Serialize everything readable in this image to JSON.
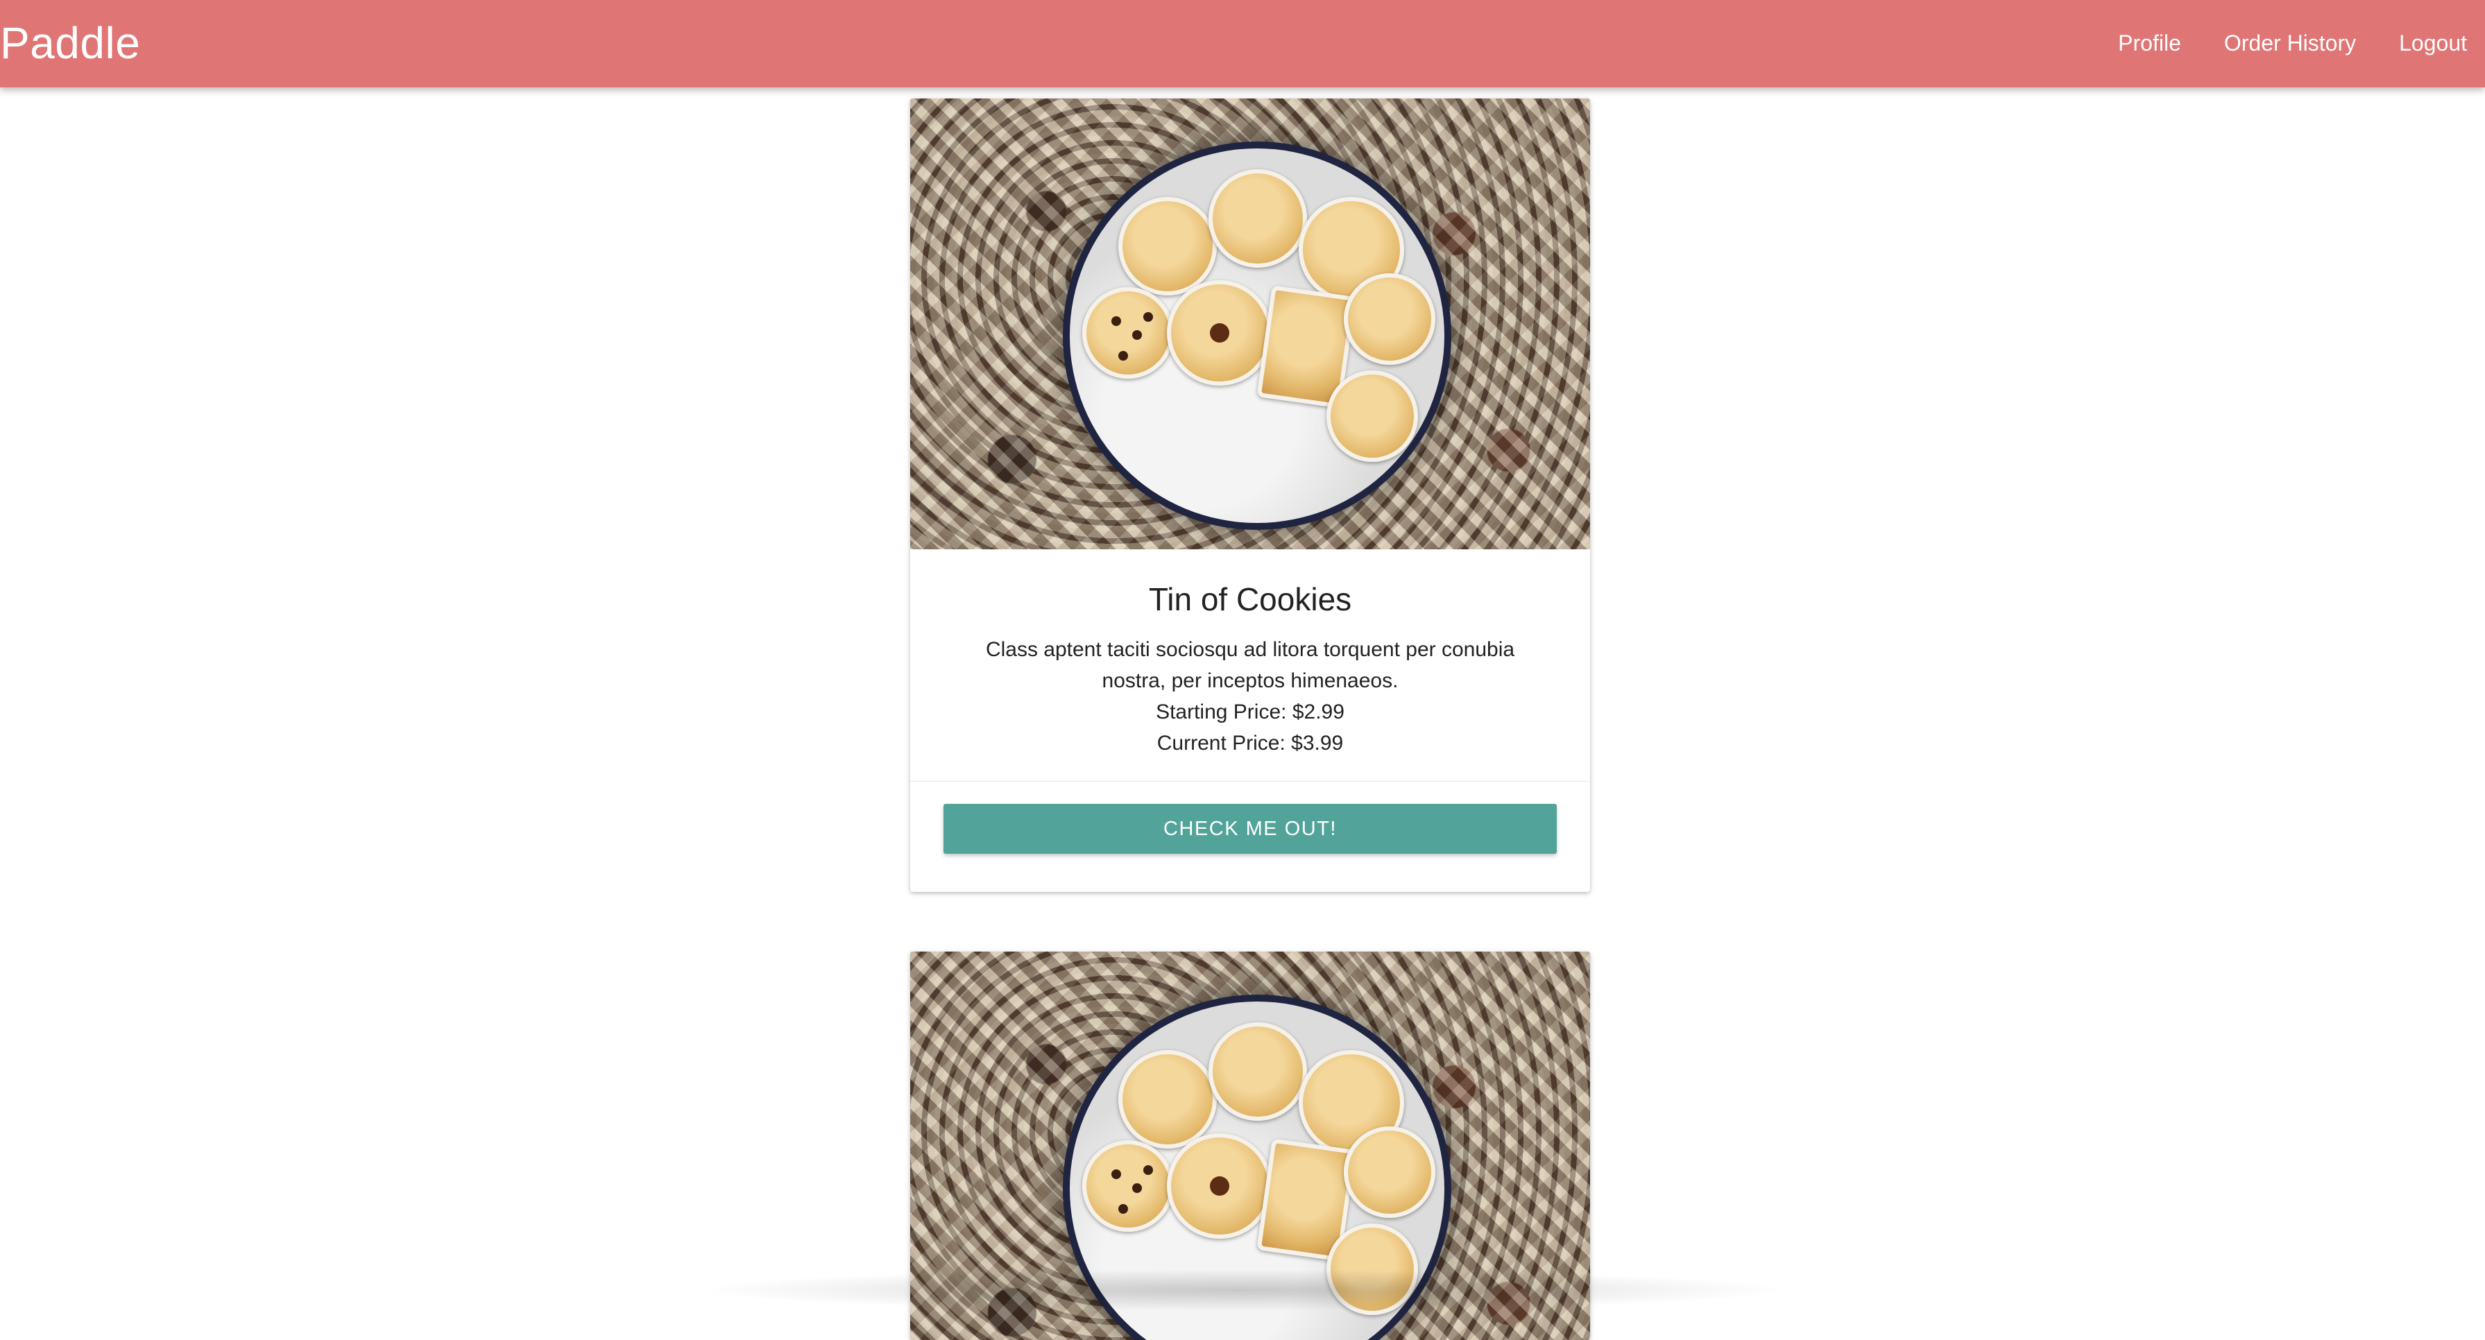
{
  "navbar": {
    "brand": "Paddle",
    "links": [
      "Profile",
      "Order History",
      "Logout"
    ],
    "color": "#e07575"
  },
  "products": [
    {
      "title": "Tin of Cookies",
      "description": "Class aptent taciti sociosqu ad litora torquent per conubia nostra, per inceptos himenaeos.",
      "starting_price": "Starting Price: $2.99",
      "current_price": "Current Price: $3.99",
      "button_label": "CHECK ME OUT!",
      "image": "cookie-tin-photo"
    },
    {
      "image": "cookie-tin-photo"
    }
  ],
  "colors": {
    "accent": "#52a49a"
  }
}
